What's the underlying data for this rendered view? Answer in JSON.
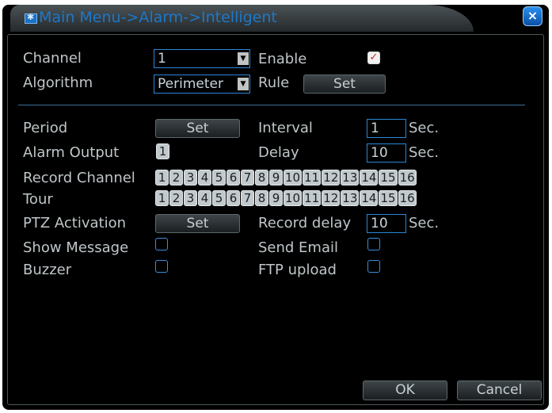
{
  "window": {
    "title": "Main Menu->Alarm->Intelligent",
    "close_label": "×"
  },
  "form": {
    "channel": {
      "label": "Channel",
      "value": "1"
    },
    "enable": {
      "label": "Enable",
      "checked": true
    },
    "algorithm": {
      "label": "Algorithm",
      "value": "Perimeter"
    },
    "rule": {
      "label": "Rule",
      "button": "Set"
    },
    "period": {
      "label": "Period",
      "button": "Set"
    },
    "interval": {
      "label": "Interval",
      "value": "1",
      "unit": "Sec."
    },
    "alarm_output": {
      "label": "Alarm Output",
      "channels": [
        "1"
      ]
    },
    "delay": {
      "label": "Delay",
      "value": "10",
      "unit": "Sec."
    },
    "record_channel": {
      "label": "Record Channel",
      "channels": [
        "1",
        "2",
        "3",
        "4",
        "5",
        "6",
        "7",
        "8",
        "9",
        "10",
        "11",
        "12",
        "13",
        "14",
        "15",
        "16"
      ]
    },
    "tour": {
      "label": "Tour",
      "channels": [
        "1",
        "2",
        "3",
        "4",
        "5",
        "6",
        "7",
        "8",
        "9",
        "10",
        "11",
        "12",
        "13",
        "14",
        "15",
        "16"
      ]
    },
    "ptz_activation": {
      "label": "PTZ Activation",
      "button": "Set"
    },
    "record_delay": {
      "label": "Record delay",
      "value": "10",
      "unit": "Sec."
    },
    "show_message": {
      "label": "Show Message",
      "checked": false
    },
    "send_email": {
      "label": "Send Email",
      "checked": false
    },
    "buzzer": {
      "label": "Buzzer",
      "checked": false
    },
    "ftp_upload": {
      "label": "FTP upload",
      "checked": false
    }
  },
  "footer": {
    "ok_label": "OK",
    "cancel_label": "Cancel"
  },
  "colors": {
    "accent": "#1d78c9",
    "background": "#000000",
    "text": "#bfc6c9"
  }
}
